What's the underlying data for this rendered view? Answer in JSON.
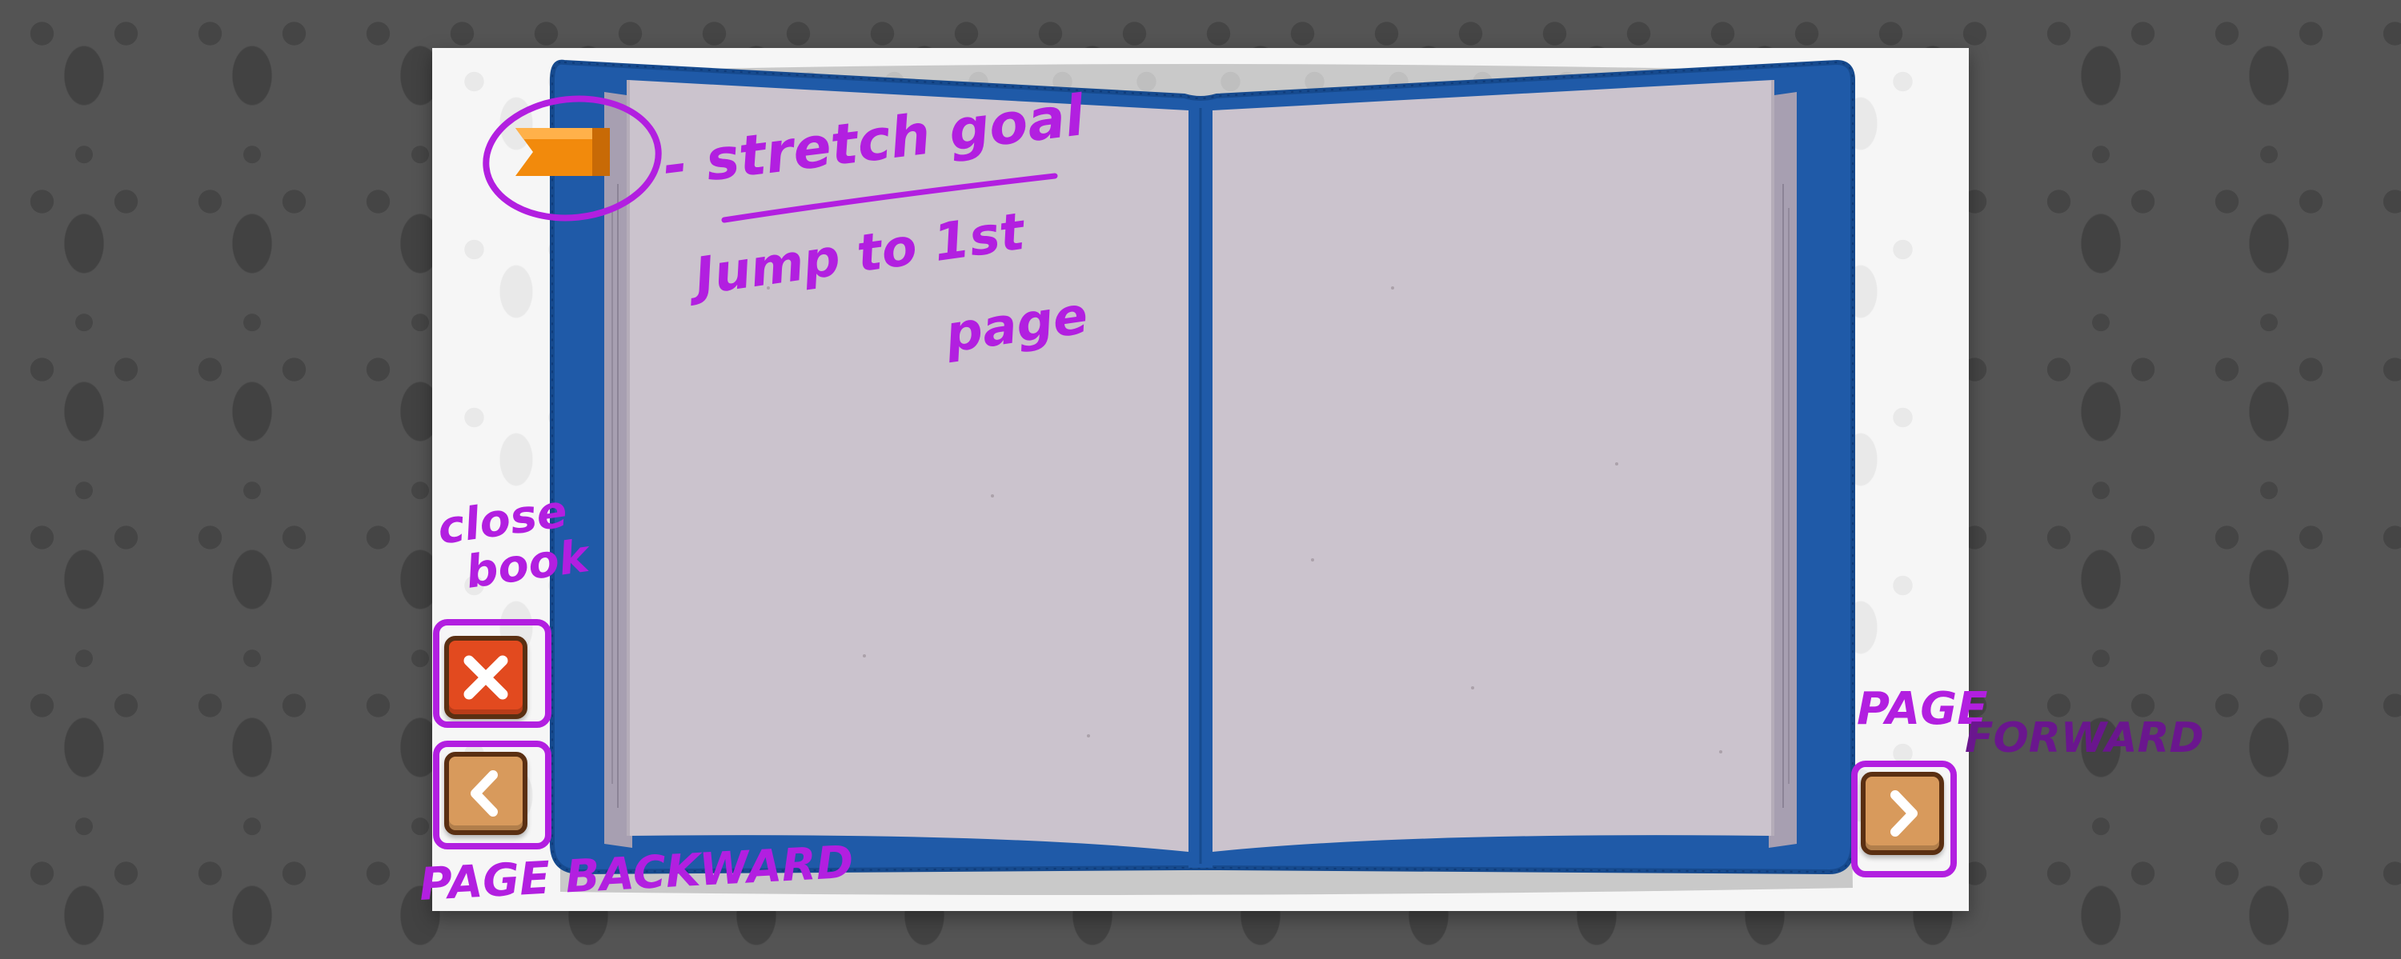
{
  "colors": {
    "background": "#545454",
    "book_cover": "#1f5aa8",
    "page": "#cbc3cd",
    "annotation_ink": "#b21fe0",
    "close_button": "#e24a1f",
    "nav_button": "#d89a5c"
  },
  "icons": {
    "bookmark": "bookmark-ribbon-icon",
    "close": "close-x-icon",
    "back": "chevron-left-icon",
    "forward": "chevron-right-icon"
  },
  "annotations": {
    "bookmark_note": "- stretch goal",
    "bookmark_note_line2": "Jump to 1st",
    "bookmark_note_line3": "page",
    "close_note_line1": "close",
    "close_note_line2": "book",
    "back_note": "PAGE BACKWARD",
    "forward_note_line1": "PAGE",
    "forward_note_line2": "FORWARD"
  }
}
